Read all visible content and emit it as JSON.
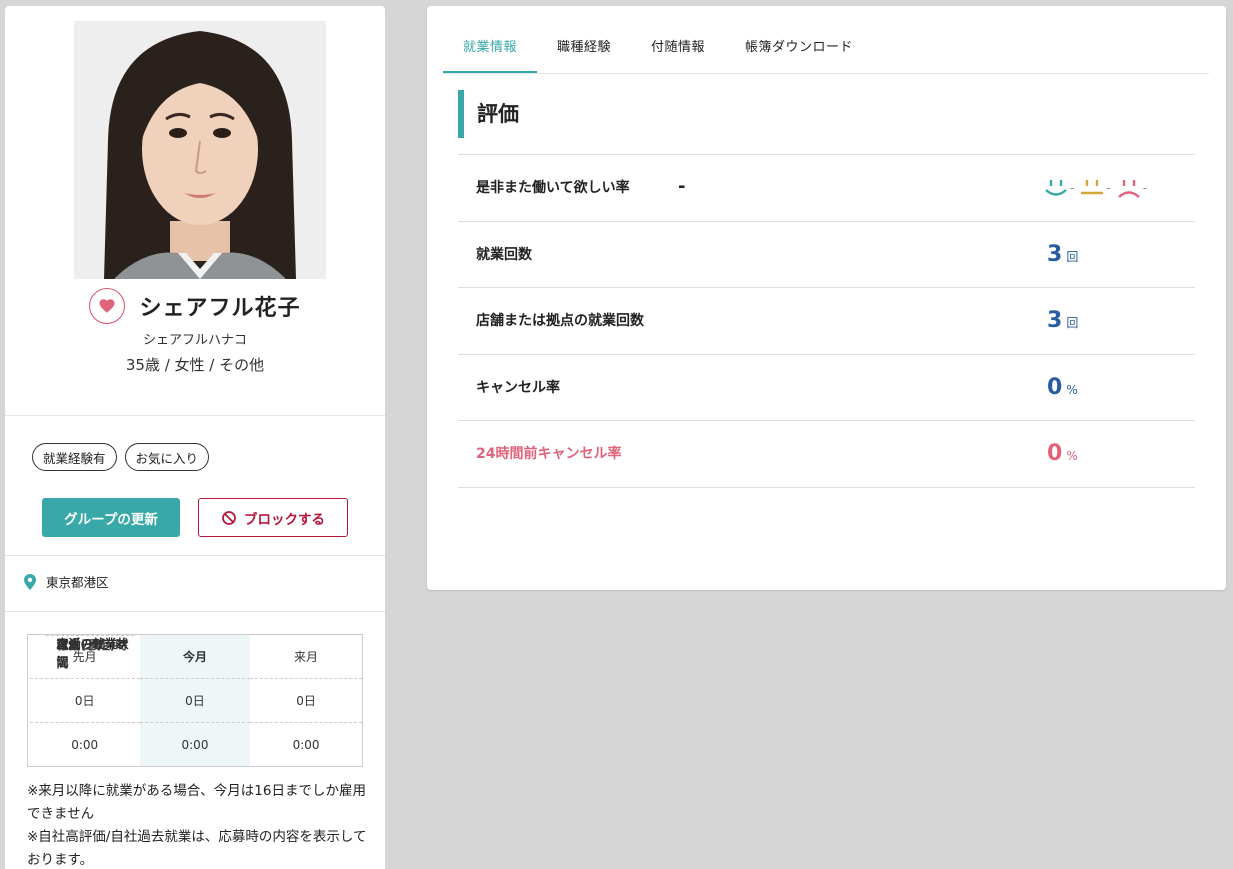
{
  "profile": {
    "name": "シェアフル花子",
    "kana": "シェアフルハナコ",
    "meta": "35歳 / 女性 / その他",
    "tags": [
      "就業経験有",
      "お気に入り"
    ],
    "group_button": "グループの更新",
    "block_button": "ブロックする",
    "location": "東京都港区"
  },
  "work_status": {
    "header": [
      "直近の就業状況",
      "先月",
      "今月",
      "来月"
    ],
    "rows": [
      {
        "label": "就業日数",
        "values": [
          "0日",
          "0日",
          "0日"
        ]
      },
      {
        "label": "稼働(予定)時間",
        "values": [
          "0:00",
          "0:00",
          "0:00"
        ]
      }
    ]
  },
  "notes": [
    "※来月以降に就業がある場合、今月は16日までしか雇用できません",
    "※自社高評価/自社過去就業は、応募時の内容を表示しております。"
  ],
  "tabs": [
    "就業情報",
    "職種経験",
    "付随情報",
    "帳簿ダウンロード"
  ],
  "section_title": "評価",
  "evaluation": {
    "rehire_label": "是非また働いて欲しい率",
    "rehire_value": "-",
    "faces": [
      {
        "icon": "smile-face-icon",
        "value": "-",
        "color": "#38a9a8"
      },
      {
        "icon": "neutral-face-icon",
        "value": "-",
        "color": "#d4a63a"
      },
      {
        "icon": "sad-face-icon",
        "value": "-",
        "color": "#e0637c"
      }
    ],
    "stats": [
      {
        "label": "就業回数",
        "value": "3",
        "unit": "回"
      },
      {
        "label": "店舗または拠点の就業回数",
        "value": "3",
        "unit": "回"
      },
      {
        "label": "キャンセル率",
        "value": "0",
        "unit": "%"
      },
      {
        "label": "24時間前キャンセル率",
        "value": "0",
        "unit": "%"
      }
    ]
  },
  "colors": {
    "accent": "#38a9a8",
    "alert": "#e0637c",
    "value": "#2a5d9f",
    "block": "#b5163a"
  }
}
